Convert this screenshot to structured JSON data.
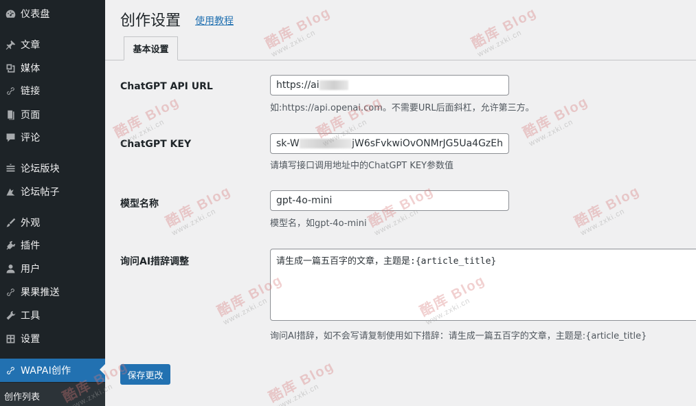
{
  "sidebar": {
    "items": [
      {
        "label": "仪表盘",
        "icon": "dashboard-icon"
      },
      {
        "label": "文章",
        "icon": "pin-icon"
      },
      {
        "label": "媒体",
        "icon": "media-icon"
      },
      {
        "label": "链接",
        "icon": "link-icon"
      },
      {
        "label": "页面",
        "icon": "page-icon"
      },
      {
        "label": "评论",
        "icon": "comment-icon"
      },
      {
        "label": "论坛版块",
        "icon": "forum-icon"
      },
      {
        "label": "论坛帖子",
        "icon": "topic-icon"
      },
      {
        "label": "外观",
        "icon": "brush-icon"
      },
      {
        "label": "插件",
        "icon": "plugin-icon"
      },
      {
        "label": "用户",
        "icon": "user-icon"
      },
      {
        "label": "果果推送",
        "icon": "link-icon"
      },
      {
        "label": "工具",
        "icon": "wrench-icon"
      },
      {
        "label": "设置",
        "icon": "settings-icon"
      },
      {
        "label": "WAPAI创作",
        "icon": "link-icon",
        "active": true
      }
    ],
    "submenu": {
      "label": "创作列表"
    }
  },
  "main": {
    "title": "创作设置",
    "tutorial_link": "使用教程",
    "tab": "基本设置",
    "fields": {
      "api_url": {
        "label": "ChatGPT API URL",
        "value_prefix": "https://ai",
        "description": "如:https://api.openai.com。不需要URL后面斜杠，允许第三方。"
      },
      "api_key": {
        "label": "ChatGPT KEY",
        "value_prefix": "sk-W",
        "value_suffix": "jW6sFvkwiOvONMrJG5Ua4GzEh",
        "description": "请填写接口调用地址中的ChatGPT KEY参数值"
      },
      "model": {
        "label": "模型名称",
        "value": "gpt-4o-mini",
        "description": "模型名，如gpt-4o-mini"
      },
      "prompt": {
        "label": "询问AI措辞调整",
        "value": "请生成一篇五百字的文章，主题是:{article_title}",
        "description": "询问AI措辞，如不会写请复制使用如下措辞：请生成一篇五百字的文章，主题是:{article_title}"
      }
    },
    "save_button": "保存更改"
  },
  "watermark": {
    "text": "酷库 Blog",
    "url": "www.zxki.cn"
  },
  "colors": {
    "sidebar_bg": "#1d2327",
    "accent": "#2271b1",
    "page_bg": "#f0f0f1"
  }
}
